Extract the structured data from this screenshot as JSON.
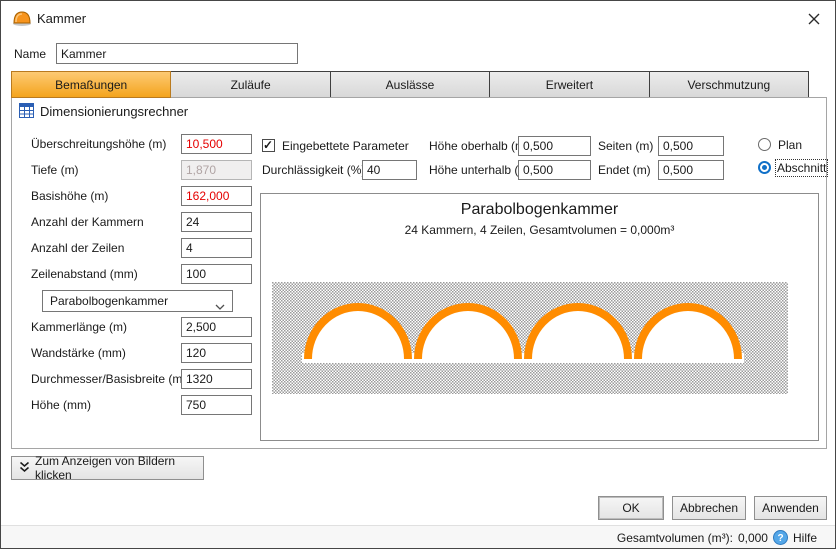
{
  "window": {
    "title": "Kammer"
  },
  "name_field": {
    "label": "Name",
    "value": "Kammer"
  },
  "tabs": [
    {
      "label": "Bemaßungen",
      "active": true
    },
    {
      "label": "Zuläufe",
      "active": false
    },
    {
      "label": "Auslässe",
      "active": false
    },
    {
      "label": "Erweitert",
      "active": false
    },
    {
      "label": "Verschmutzung",
      "active": false
    }
  ],
  "section": {
    "title": "Dimensionierungsrechner"
  },
  "left_fields": [
    {
      "label": "Überschreitungshöhe (m)",
      "value": "10,500",
      "state": "red"
    },
    {
      "label": "Tiefe (m)",
      "value": "1,870",
      "state": "disabled"
    },
    {
      "label": "Basishöhe (m)",
      "value": "162,000",
      "state": "red"
    },
    {
      "label": "Anzahl der Kammern",
      "value": "24",
      "state": "normal"
    },
    {
      "label": "Anzahl der Zeilen",
      "value": "4",
      "state": "normal"
    },
    {
      "label": "Zeilenabstand (mm)",
      "value": "100",
      "state": "normal"
    }
  ],
  "chamber_type": {
    "value": "Parabolbogenkammer"
  },
  "left_fields2": [
    {
      "label": "Kammerlänge (m)",
      "value": "2,500",
      "state": "normal"
    },
    {
      "label": "Wandstärke (mm)",
      "value": "120",
      "state": "normal"
    },
    {
      "label": "Durchmesser/Basisbreite (mm)",
      "value": "1320",
      "state": "normal"
    },
    {
      "label": "Höhe (mm)",
      "value": "750",
      "state": "normal"
    }
  ],
  "embedded": {
    "checkbox_label": "Eingebettete Parameter",
    "checked": true,
    "durchlaessigkeit": {
      "label": "Durchlässigkeit (%)",
      "value": "40"
    },
    "hoehe_oberhalb": {
      "label": "Höhe oberhalb (m)",
      "value": "0,500"
    },
    "hoehe_unterhalb": {
      "label": "Höhe unterhalb (m)",
      "value": "0,500"
    },
    "seiten": {
      "label": "Seiten (m)",
      "value": "0,500"
    },
    "endet": {
      "label": "Endet (m)",
      "value": "0,500"
    },
    "view_options": [
      {
        "label": "Plan",
        "selected": false
      },
      {
        "label": "Abschnitt",
        "selected": true
      }
    ]
  },
  "preview": {
    "title": "Parabolbogenkammer",
    "subtitle": "24 Kammern, 4 Zeilen, Gesamtvolumen = 0,000m³",
    "arch_count": 4,
    "arch_color": "#FF8C00",
    "hatch_color": "#9b9b9b"
  },
  "images_button": {
    "label": "Zum Anzeigen von Bildern klicken"
  },
  "footer": {
    "ok": "OK",
    "cancel": "Abbrechen",
    "apply": "Anwenden"
  },
  "statusbar": {
    "total_label": "Gesamtvolumen (m³):",
    "total_value": "0,000",
    "help_label": "Hilfe"
  },
  "icons": {
    "titlebar": "chamber-icon",
    "section": "calculator-grid-icon",
    "close": "close-x-icon",
    "combo": "chevron-down-icon",
    "images_button": "double-chevron-down-icon",
    "help": "help-question-icon"
  }
}
